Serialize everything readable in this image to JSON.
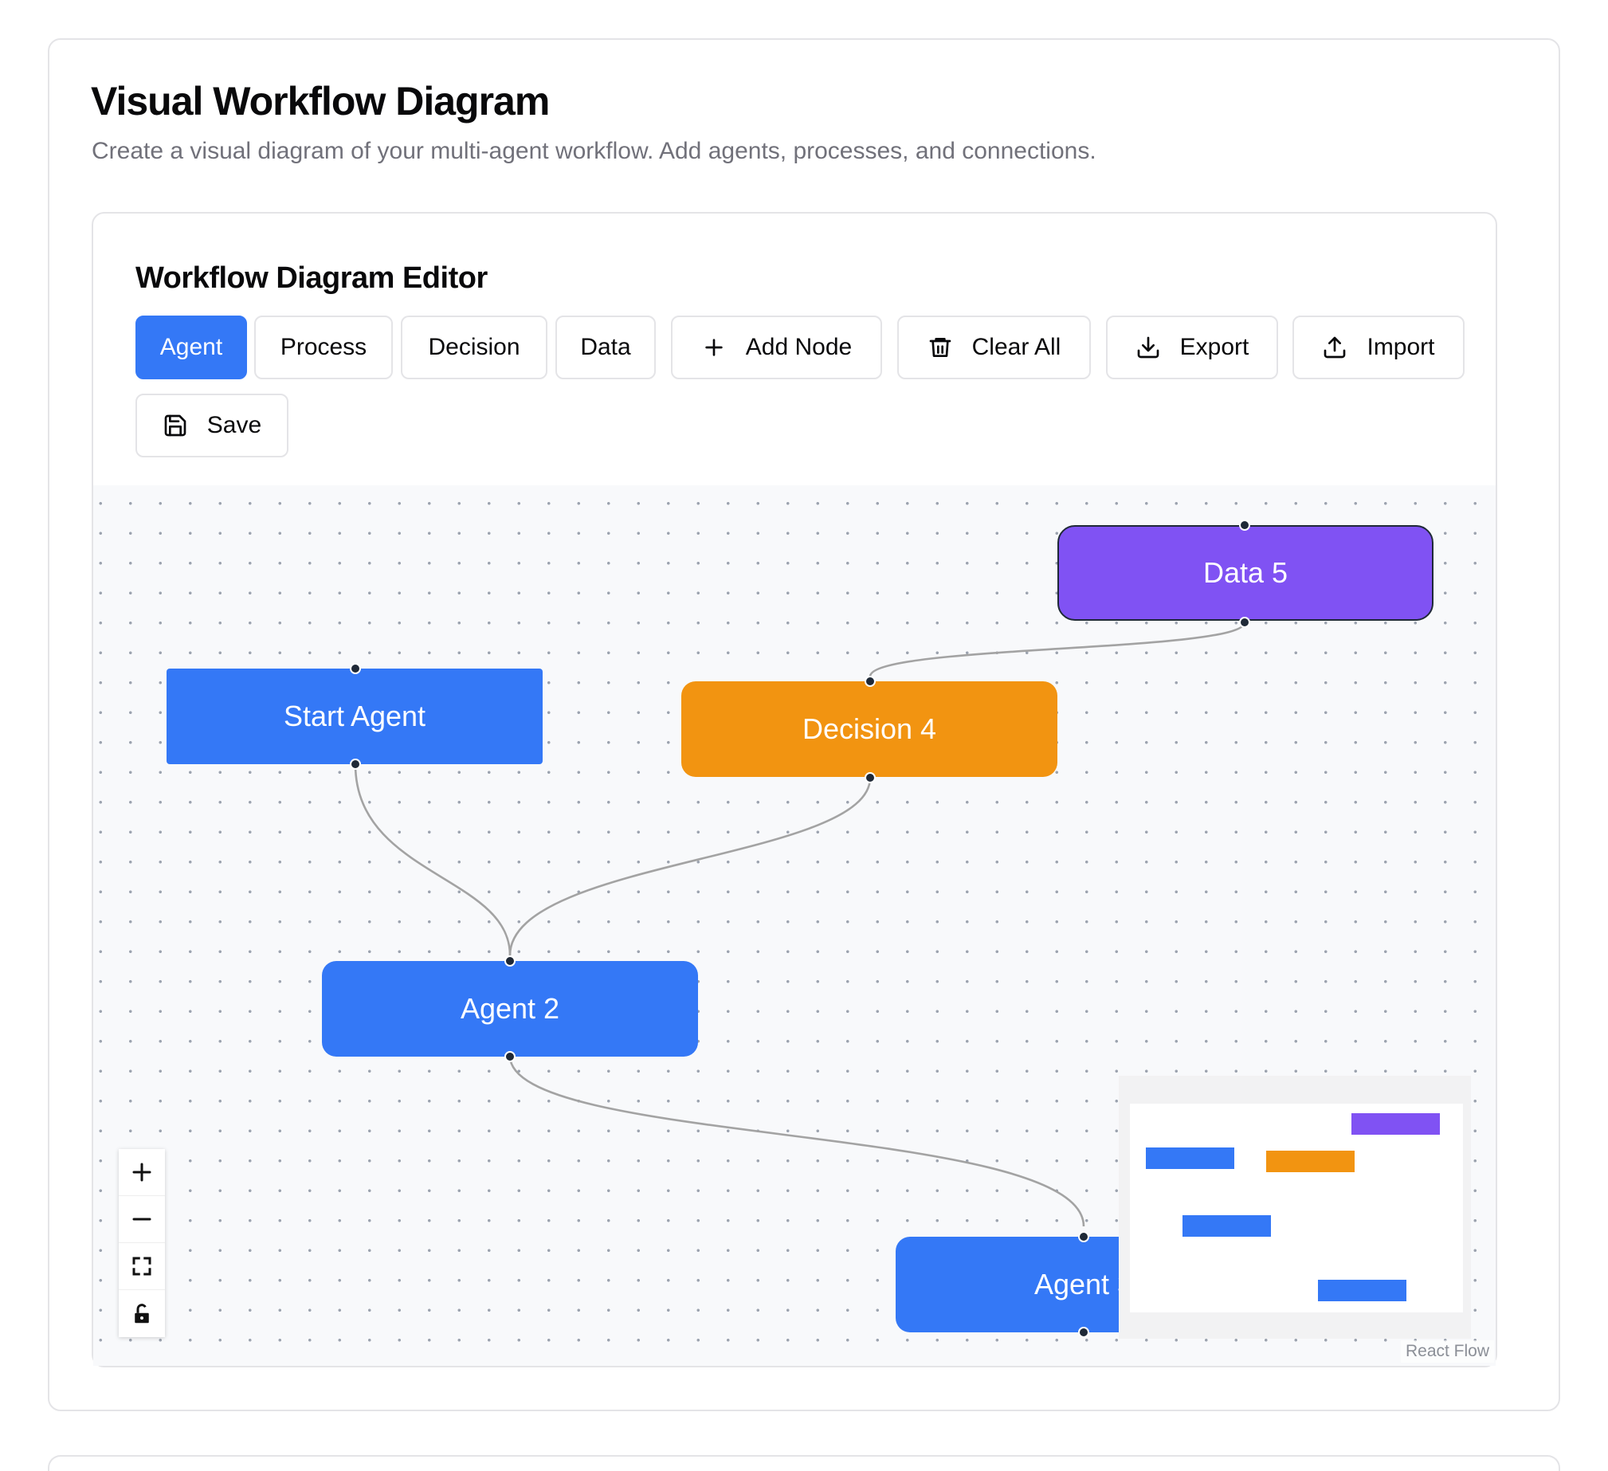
{
  "header": {
    "title": "Visual Workflow Diagram",
    "subtitle": "Create a visual diagram of your multi-agent workflow. Add agents, processes, and connections."
  },
  "editor": {
    "title": "Workflow Diagram Editor",
    "node_types": [
      "Agent",
      "Process",
      "Decision",
      "Data"
    ],
    "selected_node_type": "Agent",
    "actions": {
      "add_node": "Add Node",
      "clear_all": "Clear All",
      "export": "Export",
      "import": "Import",
      "save": "Save"
    }
  },
  "diagram": {
    "nodes": [
      {
        "id": "start",
        "label": "Start Agent",
        "type": "agent",
        "color": "#3478f6"
      },
      {
        "id": "agent2",
        "label": "Agent 2",
        "type": "agent",
        "color": "#3478f6"
      },
      {
        "id": "agent3",
        "label": "Agent 3",
        "type": "agent",
        "color": "#3478f6"
      },
      {
        "id": "decision4",
        "label": "Decision 4",
        "type": "decision",
        "color": "#f29411"
      },
      {
        "id": "data5",
        "label": "Data 5",
        "type": "data",
        "color": "#8052f3"
      }
    ],
    "edges": [
      {
        "from": "start",
        "to": "agent2"
      },
      {
        "from": "decision4",
        "to": "agent2"
      },
      {
        "from": "data5",
        "to": "decision4"
      },
      {
        "from": "agent2",
        "to": "agent3"
      }
    ],
    "controls": [
      "zoom-in",
      "zoom-out",
      "fit-view",
      "lock"
    ],
    "attribution": "React Flow"
  },
  "colors": {
    "agent": "#3478f6",
    "decision": "#f29411",
    "data": "#8052f3",
    "edge": "#a3a3a3"
  }
}
